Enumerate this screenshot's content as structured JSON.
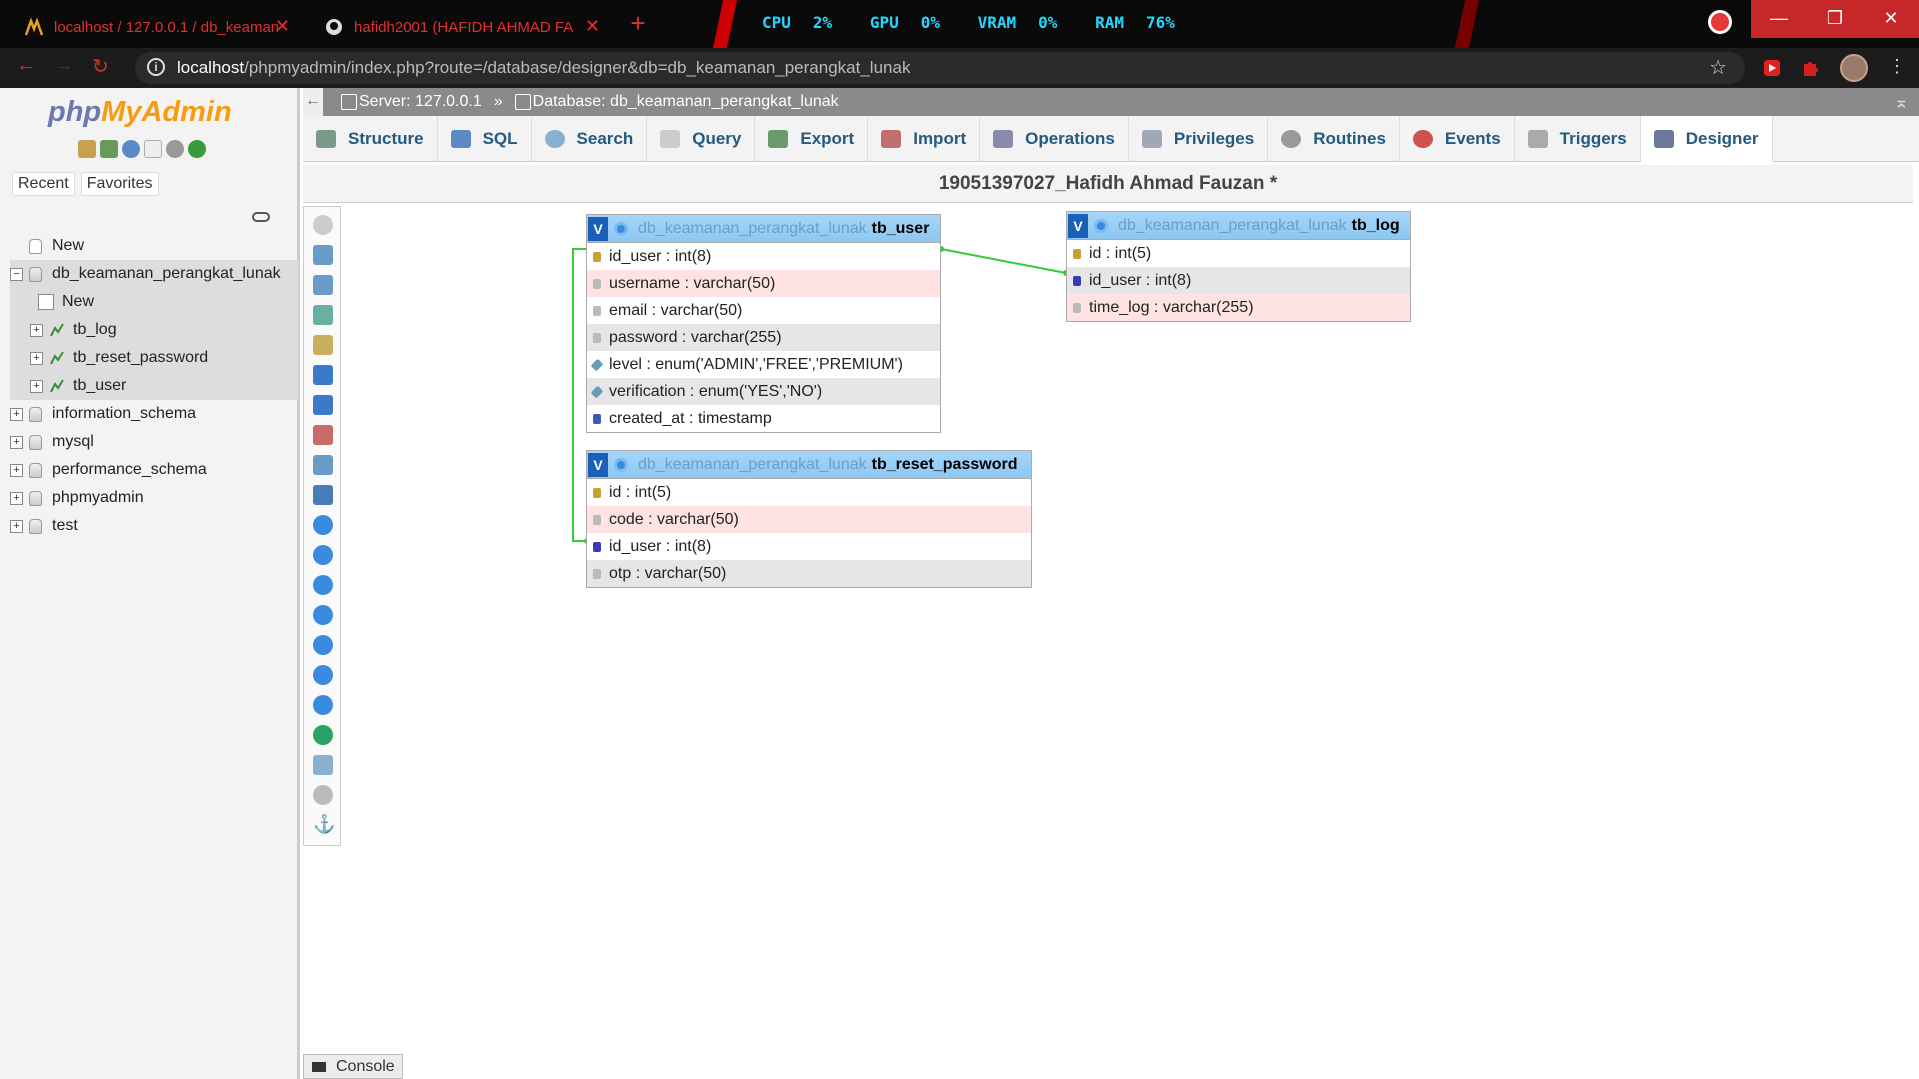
{
  "browser": {
    "tabs": [
      {
        "title": "localhost / 127.0.0.1 / db_keaman",
        "icon": "phpmyadmin-tab-icon"
      },
      {
        "title": "hafidh2001 (HAFIDH AHMAD FA",
        "icon": "github-icon"
      }
    ],
    "stats": [
      {
        "label": "CPU",
        "value": "2%"
      },
      {
        "label": "GPU",
        "value": "0%"
      },
      {
        "label": "VRAM",
        "value": "0%"
      },
      {
        "label": "RAM",
        "value": "76%"
      }
    ],
    "url_host": "localhost",
    "url_path": "/phpmyadmin/index.php?route=/database/designer&db=db_keamanan_perangkat_lunak"
  },
  "sidebar": {
    "logo_php": "php",
    "logo_myadmin": "MyAdmin",
    "tabs": [
      "Recent",
      "Favorites"
    ],
    "tree": {
      "new_top": "New",
      "current_db": "db_keamanan_perangkat_lunak",
      "db_children": [
        "New",
        "tb_log",
        "tb_reset_password",
        "tb_user"
      ],
      "other_dbs": [
        "information_schema",
        "mysql",
        "performance_schema",
        "phpmyadmin",
        "test"
      ]
    }
  },
  "breadcrumb": {
    "server": "Server: 127.0.0.1",
    "separator": "»",
    "database": "Database: db_keamanan_perangkat_lunak"
  },
  "topmenu": [
    "Structure",
    "SQL",
    "Search",
    "Query",
    "Export",
    "Import",
    "Operations",
    "Privileges",
    "Routines",
    "Events",
    "Triggers",
    "Designer"
  ],
  "page_title": "19051397027_Hafidh Ahmad Fauzan *",
  "designer": {
    "db_prefix": "db_keamanan_perangkat_lunak",
    "tables": [
      {
        "name": "tb_user",
        "columns": [
          "id_user : int(8)",
          "username : varchar(50)",
          "email : varchar(50)",
          "password : varchar(255)",
          "level : enum('ADMIN','FREE','PREMIUM')",
          "verification : enum('YES','NO')",
          "created_at : timestamp"
        ]
      },
      {
        "name": "tb_log",
        "columns": [
          "id : int(5)",
          "id_user : int(8)",
          "time_log : varchar(255)"
        ]
      },
      {
        "name": "tb_reset_password",
        "columns": [
          "id : int(5)",
          "code : varchar(50)",
          "id_user : int(8)",
          "otp : varchar(50)"
        ]
      }
    ]
  },
  "console_label": "Console",
  "colors": {
    "accent_link": "#235a81",
    "relation_line": "#33cc33",
    "table_header": "#8cc7f2",
    "stats_text": "#25d7ff"
  }
}
